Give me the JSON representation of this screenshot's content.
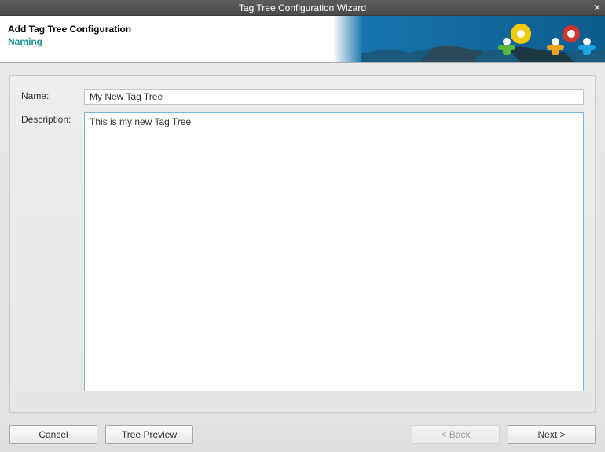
{
  "window": {
    "title": "Tag Tree Configuration Wizard"
  },
  "banner": {
    "heading": "Add Tag Tree Configuration",
    "subheading": "Naming"
  },
  "form": {
    "name_label": "Name:",
    "name_value": "My New Tag Tree",
    "description_label": "Description:",
    "description_value": "This is my new Tag Tree"
  },
  "buttons": {
    "cancel": "Cancel",
    "tree_preview": "Tree Preview",
    "back": "< Back",
    "next": "Next >"
  }
}
